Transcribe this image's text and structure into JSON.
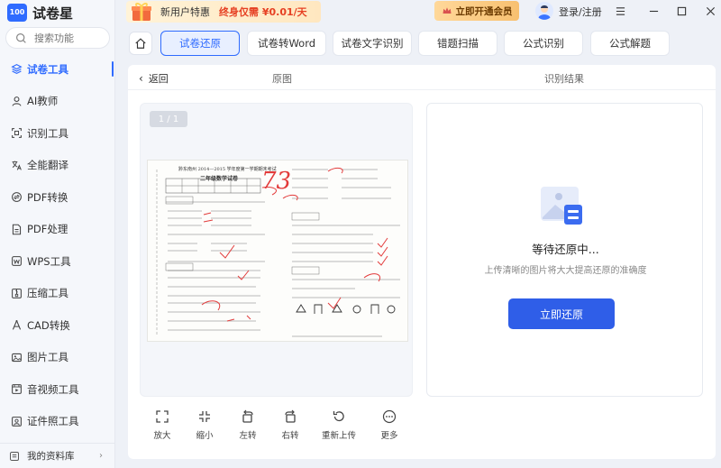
{
  "app": {
    "logo_badge": "100",
    "name": "试卷星"
  },
  "search": {
    "placeholder": "搜索功能"
  },
  "sidebar": {
    "items": [
      {
        "label": "试卷工具",
        "icon": "layers-icon",
        "active": true
      },
      {
        "label": "AI教师",
        "icon": "person-icon"
      },
      {
        "label": "识别工具",
        "icon": "scan-icon"
      },
      {
        "label": "全能翻译",
        "icon": "translate-icon"
      },
      {
        "label": "PDF转换",
        "icon": "convert-icon"
      },
      {
        "label": "PDF处理",
        "icon": "pdf-icon"
      },
      {
        "label": "WPS工具",
        "icon": "wps-icon"
      },
      {
        "label": "压缩工具",
        "icon": "compress-icon"
      },
      {
        "label": "CAD转换",
        "icon": "cad-icon"
      },
      {
        "label": "图片工具",
        "icon": "image-icon"
      },
      {
        "label": "音视频工具",
        "icon": "video-icon"
      },
      {
        "label": "证件照工具",
        "icon": "id-photo-icon"
      }
    ],
    "footer": {
      "label": "我的资料库"
    }
  },
  "topbar": {
    "promo_new": "新用户特惠",
    "promo_price": "终身仅需 ¥0.01/天",
    "vip": "立即开通会员",
    "login": "登录/注册"
  },
  "tabs": [
    {
      "label": "试卷还原",
      "active": true
    },
    {
      "label": "试卷转Word"
    },
    {
      "label": "试卷文字识别"
    },
    {
      "label": "错题扫描"
    },
    {
      "label": "公式识别"
    },
    {
      "label": "公式解题"
    }
  ],
  "subbar": {
    "back": "返回",
    "original": "原图",
    "result": "识别结果"
  },
  "preview": {
    "page_indicator": "1 / 1",
    "doc_header": "黔东南州 2014—2015 学年度第一学期期末考试",
    "doc_title": "二年级数学试卷",
    "score": "73"
  },
  "result": {
    "status": "等待还原中...",
    "hint": "上传清晰的图片将大大提高还原的准确度",
    "button": "立即还原"
  },
  "tools": [
    {
      "label": "放大",
      "icon": "expand-icon"
    },
    {
      "label": "缩小",
      "icon": "shrink-icon"
    },
    {
      "label": "左转",
      "icon": "rotate-left-icon"
    },
    {
      "label": "右转",
      "icon": "rotate-right-icon"
    },
    {
      "label": "重新上传",
      "icon": "reupload-icon"
    },
    {
      "label": "更多",
      "icon": "more-icon"
    }
  ],
  "colors": {
    "accent": "#2f6bff",
    "button": "#2f5ee8",
    "promo_red": "#e64023",
    "score_red": "#e23b3b"
  }
}
